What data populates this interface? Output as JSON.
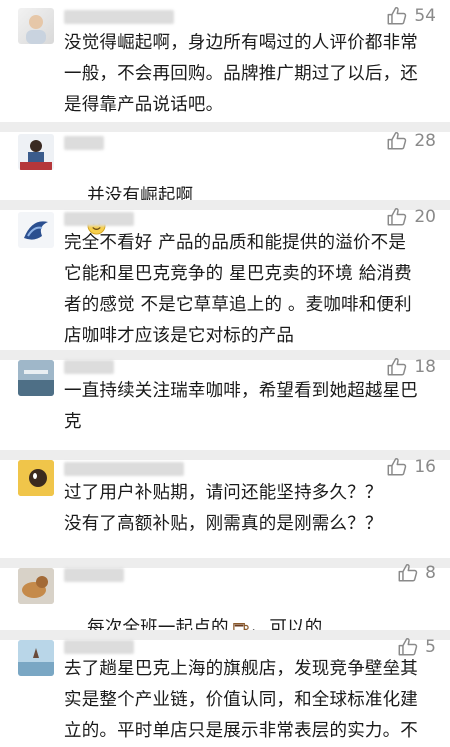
{
  "comments": [
    {
      "likes": "54",
      "text": "没觉得崛起啊，身边所有喝过的人评价都非常\n一般，不会再回购。品牌推广期过了以后，还\n是得靠产品说话吧。"
    },
    {
      "likes": "28",
      "text": "并没有崛起啊"
    },
    {
      "likes": "20",
      "text": "完全不看好 产品的品质和能提供的溢价不是\n它能和星巴克竞争的 星巴克卖的环境 給消费\n者的感觉 不是它草草追上的 。麦咖啡和便利\n店咖啡才应该是它对标的产品"
    },
    {
      "likes": "18",
      "text": "一直持续关注瑞幸咖啡，希望看到她超越星巴\n克"
    },
    {
      "likes": "16",
      "text": "过了用户补贴期，请问还能坚持多久？？\n没有了高额补贴，刚需真的是刚需么？？"
    },
    {
      "likes": "8",
      "text_before": "每次全班一起点的",
      "text_after": "、可以的"
    },
    {
      "likes": "5",
      "text": "去了趟星巴克上海的旗舰店，发现竞争壁垒其\n实是整个产业链，价值认同，和全球标准化建\n立的。平时单店只是展示非常表层的实力。不"
    }
  ],
  "icons": {
    "like": "thumbs-up-icon",
    "smile": "smiley-emoji-icon",
    "coffee": "coffee-cup-emoji-icon"
  },
  "colors": {
    "background": "#ffffff",
    "separator": "#ededed",
    "text": "#1a1a1a",
    "like": "#8a8a8a"
  }
}
